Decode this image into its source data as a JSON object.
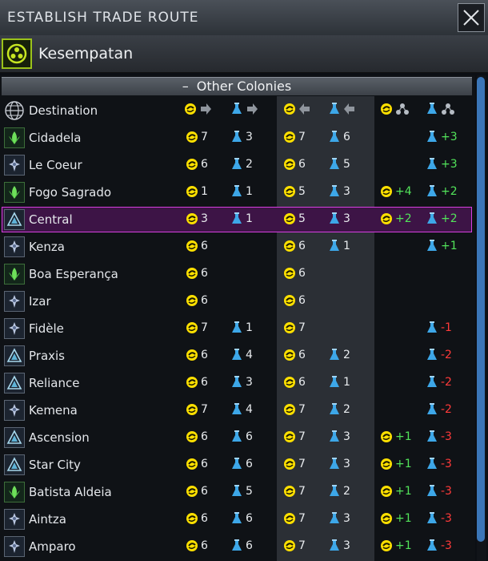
{
  "window": {
    "title": "ESTABLISH TRADE ROUTE"
  },
  "faction": {
    "name": "Kesempatan",
    "icon": "faction-emblem-icon"
  },
  "section": {
    "label": "Other Colonies",
    "toggle": "–"
  },
  "header": {
    "destination": "Destination"
  },
  "colors": {
    "accent_green": "#52e35a",
    "negative_red": "#ff3a3a",
    "selected": "#d63fe0",
    "gold": "#ffe000",
    "science": "#3da7e8"
  },
  "rows": [
    {
      "name": "Cidadela",
      "icon": "green",
      "g_out": "7",
      "s_out": "3",
      "g_in": "7",
      "s_in": "6",
      "g_net": "",
      "s_net": "+3",
      "s_sign": "pos"
    },
    {
      "name": "Le Coeur",
      "icon": "blue",
      "g_out": "6",
      "s_out": "2",
      "g_in": "6",
      "s_in": "5",
      "g_net": "",
      "s_net": "+3",
      "s_sign": "pos"
    },
    {
      "name": "Fogo Sagrado",
      "icon": "green",
      "g_out": "1",
      "s_out": "1",
      "g_in": "5",
      "s_in": "3",
      "g_net": "+4",
      "s_net": "+2",
      "s_sign": "pos"
    },
    {
      "name": "Central",
      "icon": "teal",
      "selected": true,
      "g_out": "3",
      "s_out": "1",
      "g_in": "5",
      "s_in": "3",
      "g_net": "+2",
      "s_net": "+2",
      "s_sign": "pos"
    },
    {
      "name": "Kenza",
      "icon": "blue",
      "g_out": "6",
      "s_out": "",
      "g_in": "6",
      "s_in": "1",
      "g_net": "",
      "s_net": "+1",
      "s_sign": "pos"
    },
    {
      "name": "Boa Esperança",
      "icon": "green",
      "g_out": "6",
      "s_out": "",
      "g_in": "6",
      "s_in": "",
      "g_net": "",
      "s_net": "",
      "s_sign": "pos"
    },
    {
      "name": "Izar",
      "icon": "blue",
      "g_out": "6",
      "s_out": "",
      "g_in": "6",
      "s_in": "",
      "g_net": "",
      "s_net": "",
      "s_sign": "pos"
    },
    {
      "name": "Fidèle",
      "icon": "blue",
      "g_out": "7",
      "s_out": "1",
      "g_in": "7",
      "s_in": "",
      "g_net": "",
      "s_net": "-1",
      "s_sign": "neg"
    },
    {
      "name": "Praxis",
      "icon": "teal",
      "g_out": "6",
      "s_out": "4",
      "g_in": "6",
      "s_in": "2",
      "g_net": "",
      "s_net": "-2",
      "s_sign": "neg"
    },
    {
      "name": "Reliance",
      "icon": "teal",
      "g_out": "6",
      "s_out": "3",
      "g_in": "6",
      "s_in": "1",
      "g_net": "",
      "s_net": "-2",
      "s_sign": "neg"
    },
    {
      "name": "Kemena",
      "icon": "blue",
      "g_out": "7",
      "s_out": "4",
      "g_in": "7",
      "s_in": "2",
      "g_net": "",
      "s_net": "-2",
      "s_sign": "neg"
    },
    {
      "name": "Ascension",
      "icon": "teal",
      "g_out": "6",
      "s_out": "6",
      "g_in": "7",
      "s_in": "3",
      "g_net": "+1",
      "s_net": "-3",
      "s_sign": "neg"
    },
    {
      "name": "Star City",
      "icon": "teal",
      "g_out": "6",
      "s_out": "6",
      "g_in": "7",
      "s_in": "3",
      "g_net": "+1",
      "s_net": "-3",
      "s_sign": "neg"
    },
    {
      "name": "Batista Aldeia",
      "icon": "green",
      "g_out": "6",
      "s_out": "5",
      "g_in": "7",
      "s_in": "2",
      "g_net": "+1",
      "s_net": "-3",
      "s_sign": "neg"
    },
    {
      "name": "Aintza",
      "icon": "blue",
      "g_out": "6",
      "s_out": "6",
      "g_in": "7",
      "s_in": "3",
      "g_net": "+1",
      "s_net": "-3",
      "s_sign": "neg"
    },
    {
      "name": "Amparo",
      "icon": "blue",
      "g_out": "6",
      "s_out": "6",
      "g_in": "7",
      "s_in": "3",
      "g_net": "+1",
      "s_net": "-3",
      "s_sign": "neg"
    }
  ]
}
